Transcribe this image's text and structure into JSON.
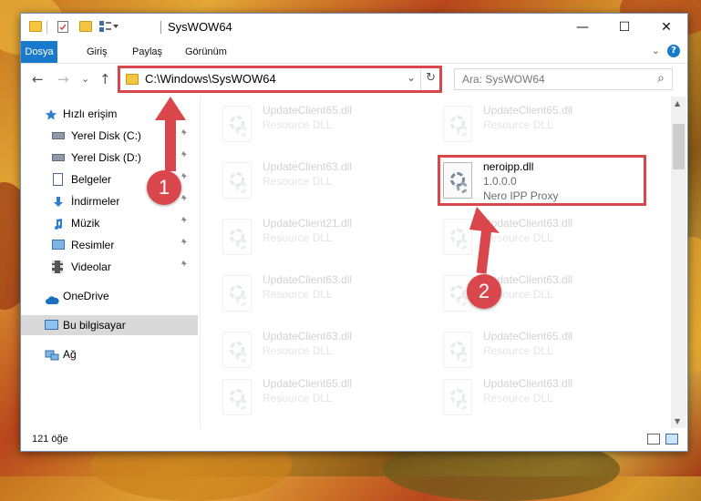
{
  "window": {
    "title": "SysWOW64",
    "controls": {
      "minimize": "—",
      "maximize": "☐",
      "close": "✕"
    }
  },
  "ribbon": {
    "tabs": [
      "Dosya",
      "Giriş",
      "Paylaş",
      "Görünüm"
    ],
    "expand_glyph": "⌄",
    "help_glyph": "?"
  },
  "nav": {
    "back": "←",
    "forward": "→",
    "recent": "⌄",
    "up": "↑",
    "address": "C:\\Windows\\SysWOW64",
    "dropdown": "⌄",
    "refresh": "↻",
    "search_placeholder": "Ara: SysWOW64",
    "search_glyph": "⌕"
  },
  "sidebar": {
    "items": [
      {
        "label": "Hızlı erişim",
        "icon": "star-icon",
        "pinned": false
      },
      {
        "label": "Yerel Disk (C:)",
        "icon": "drive-icon",
        "pinned": true
      },
      {
        "label": "Yerel Disk (D:)",
        "icon": "drive-icon",
        "pinned": true
      },
      {
        "label": "Belgeler",
        "icon": "documents-icon",
        "pinned": true
      },
      {
        "label": "İndirmeler",
        "icon": "downloads-icon",
        "pinned": true
      },
      {
        "label": "Müzik",
        "icon": "music-icon",
        "pinned": true
      },
      {
        "label": "Resimler",
        "icon": "pictures-icon",
        "pinned": true
      },
      {
        "label": "Videolar",
        "icon": "videos-icon",
        "pinned": true
      },
      {
        "label": "OneDrive",
        "icon": "cloud-icon",
        "pinned": false
      },
      {
        "label": "Bu bilgisayar",
        "icon": "computer-icon",
        "pinned": false,
        "selected": true
      },
      {
        "label": "Ağ",
        "icon": "network-icon",
        "pinned": false
      }
    ],
    "pin_glyph": "📌"
  },
  "files": [
    {
      "name": "UpdateClient65.dll",
      "desc": "Resource DLL"
    },
    {
      "name": "UpdateClient65.dll",
      "desc": "Resource DLL"
    },
    {
      "name": "UpdateClient63.dll",
      "desc": "Resource DLL"
    },
    {
      "name": "neroipp.dll",
      "version": "1.0.0.0",
      "desc": "Nero IPP Proxy",
      "highlighted": true
    },
    {
      "name": "UpdateClient21.dll",
      "desc": "Resource DLL"
    },
    {
      "name": "UpdateClient63.dll",
      "desc": "Resource DLL"
    },
    {
      "name": "UpdateClient63.dll",
      "desc": "Resource DLL"
    },
    {
      "name": "UpdateClient63.dll",
      "desc": "Resource DLL"
    },
    {
      "name": "UpdateClient63.dll",
      "desc": "Resource DLL"
    },
    {
      "name": "UpdateClient65.dll",
      "desc": "Resource DLL"
    },
    {
      "name": "UpdateClient65.dll",
      "desc": "Resource DLL"
    },
    {
      "name": "UpdateClient63.dll",
      "desc": "Resource DLL"
    }
  ],
  "status": {
    "item_count": "121 öğe"
  },
  "annotations": {
    "step1": "1",
    "step2": "2"
  },
  "colors": {
    "accent": "#1979ca",
    "highlight": "#d9474d"
  }
}
